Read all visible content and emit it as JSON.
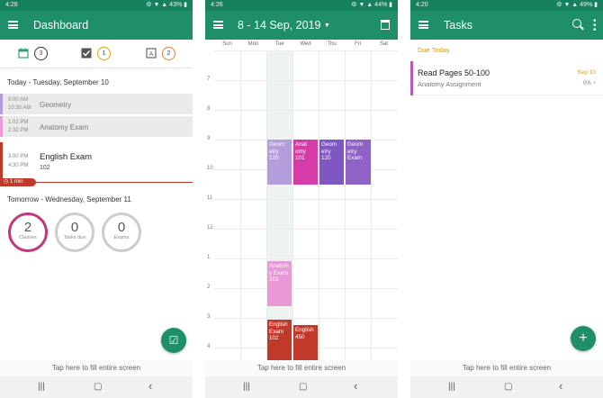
{
  "colors": {
    "primary": "#1f8f6a",
    "status": "#17805f",
    "red": "#c0392b",
    "purple": "#7e57c2",
    "lavender": "#b39ddb",
    "magenta": "#d63ca7",
    "pink": "#e99ad6",
    "gold": "#d4a017"
  },
  "screen1": {
    "status": {
      "time": "4:28",
      "icons": "⚙ ▼ ▲ 43% ▮"
    },
    "title": "Dashboard",
    "summary": [
      {
        "icon": "calendar-icon",
        "count": "3"
      },
      {
        "icon": "check-icon",
        "count": "1"
      },
      {
        "icon": "exam-icon",
        "count": "2"
      }
    ],
    "today_label": "Today - Tuesday, September 10",
    "events": [
      {
        "start": "9:00 AM",
        "end": "10:30 AM",
        "name": "Geometry"
      },
      {
        "start": "1:02 PM",
        "end": "2:32 PM",
        "name": "Anatomy Exam"
      },
      {
        "start": "3:00 PM",
        "end": "4:30 PM",
        "name": "English Exam",
        "room": "102"
      }
    ],
    "now_badge": "1 min",
    "tomorrow_label": "Tomorrow - Wednesday, September 11",
    "stats": [
      {
        "value": "2",
        "label": "Classes"
      },
      {
        "value": "0",
        "label": "Tasks due"
      },
      {
        "value": "0",
        "label": "Exams"
      }
    ],
    "tap_text": "Tap here to fill entire screen"
  },
  "screen2": {
    "status": {
      "time": "4:26",
      "icons": "⚙ ▼ ▲ 44% ▮"
    },
    "title": "8 - 14 Sep, 2019",
    "days": [
      "Sun",
      "Mon",
      "Tue",
      "Wed",
      "Thu",
      "Fri",
      "Sat"
    ],
    "hours": [
      "7",
      "8",
      "9",
      "10",
      "11",
      "12",
      "1",
      "2",
      "3",
      "4"
    ],
    "events": [
      {
        "label": "Geom etry",
        "room": "120"
      },
      {
        "label": "Anat omy",
        "room": "101"
      },
      {
        "label": "Geom etry",
        "room": "120"
      },
      {
        "label": "Geom etry Exam",
        "room": ""
      },
      {
        "label": "Anatom y Exam",
        "room": "102"
      },
      {
        "label": "English Exam",
        "room": "102"
      },
      {
        "label": "English",
        "room": "450"
      }
    ],
    "tap_text": "Tap here to fill entire screen"
  },
  "screen3": {
    "status": {
      "time": "4:20",
      "icons": "⚙ ▼ ▲ 49% ▮"
    },
    "title": "Tasks",
    "due_label": "Due Today",
    "task": {
      "name": "Read Pages 50-100",
      "subject": "Anatomy Assignment",
      "date": "Sep 10",
      "progress": "0%"
    },
    "tap_text": "Tap here to fill entire screen"
  },
  "nav": {
    "recent": "|||",
    "home": "▢",
    "back": "‹"
  }
}
